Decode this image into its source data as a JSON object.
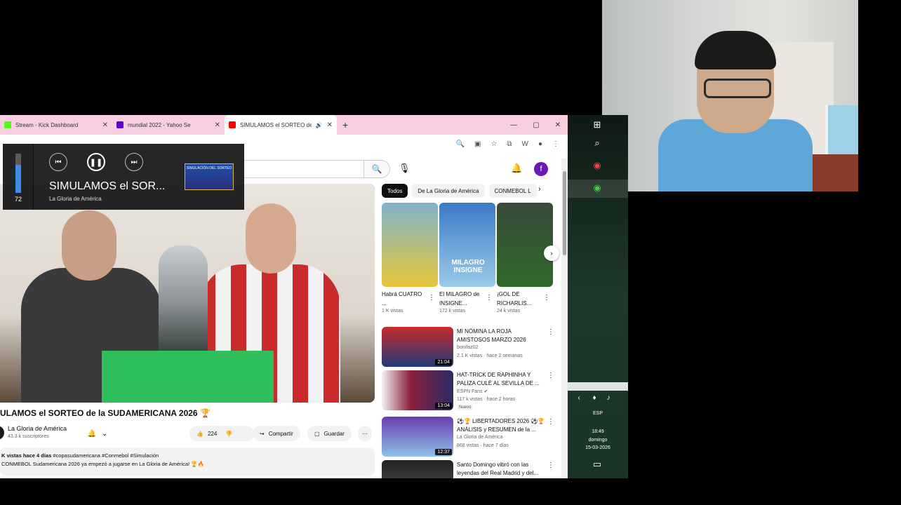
{
  "browser": {
    "tabs": [
      {
        "title": "Stream - Kick Dashboard",
        "color": "#53fc18"
      },
      {
        "title": "mundial 2022 - Yahoo Se",
        "color": "#6001d2"
      },
      {
        "title": "SIMULAMOS el SORTEO de",
        "color": "#ff0000",
        "active": true
      }
    ],
    "new_tab": "+",
    "window_controls": [
      "—",
      "▢",
      "✕"
    ]
  },
  "youtube": {
    "chips": [
      "Todos",
      "De La Gloria de América",
      "CONMEBOL L"
    ],
    "avatar_letter": "f",
    "video_title": "ULAMOS el SORTEO de la SUDAMERICANA 2026 🏆",
    "channel": {
      "name": "La Gloria de América",
      "subs": "43.3 k suscriptores"
    },
    "actions": {
      "likes": "224",
      "share": "Compartir",
      "save": "Guardar"
    },
    "description": {
      "meta": "K vistas  hace 4 días",
      "tags": "#copasudamericana #Conmebol #Simulación",
      "text": "CONMEBOL Sudamericana 2026 ya empezó a jugarse en La Gloria de América! 🏆🔥"
    },
    "shorts": [
      {
        "title": "Habrá CUATRO ...",
        "views": "1 K vistas",
        "color": "#e8c53a"
      },
      {
        "title": "El MILAGRO de INSIGNE...",
        "views": "172 k vistas",
        "color": "#5b9fd6",
        "overlay": "MILAGRO INSIGNE"
      },
      {
        "title": "¡GOL DE RICHARLIS...",
        "views": "24 k vistas",
        "color": "#3c6a2e"
      }
    ],
    "recommended": [
      {
        "title": "MI NÓMINA LA ROJA AMISTOSOS MARZO 2026",
        "channel": "bonifaz02",
        "meta": "2.1 K vistas · hace 2 semanas",
        "duration": "21:04",
        "color": "#c62b2b"
      },
      {
        "title": "HAT-TRICK DE RAPHINHA Y PALIZA CULÉ AL SEVILLA DE ...",
        "channel": "ESPN Fans ✔",
        "meta": "117 k vistas · hace 2 horas",
        "duration": "13:04",
        "badge": "Nuevo",
        "color": "#8a1f3a"
      },
      {
        "title": "⚽🏆 LIBERTADORES 2026 ⚽🏆 ANÁLISIS y RESUMEN de la ...",
        "channel": "La Gloria de América",
        "meta": "868 vistas · hace 7 días",
        "duration": "12:37",
        "color": "#6a3fb0"
      },
      {
        "title": "Santo Domingo vibró con las leyendas del Real Madrid y del...",
        "channel": "",
        "meta": "",
        "duration": "",
        "color": "#333"
      }
    ]
  },
  "media_overlay": {
    "volume": "72",
    "volume_level": 0.72,
    "title": "SIMULAMOS el SOR...",
    "channel": "La Gloria de América",
    "thumb_text": "SIMULACIÓN DEL SORTEO"
  },
  "taskbar": {
    "lang": "ESP",
    "time": "18:49",
    "day": "domingo",
    "date": "15-03-2026"
  }
}
